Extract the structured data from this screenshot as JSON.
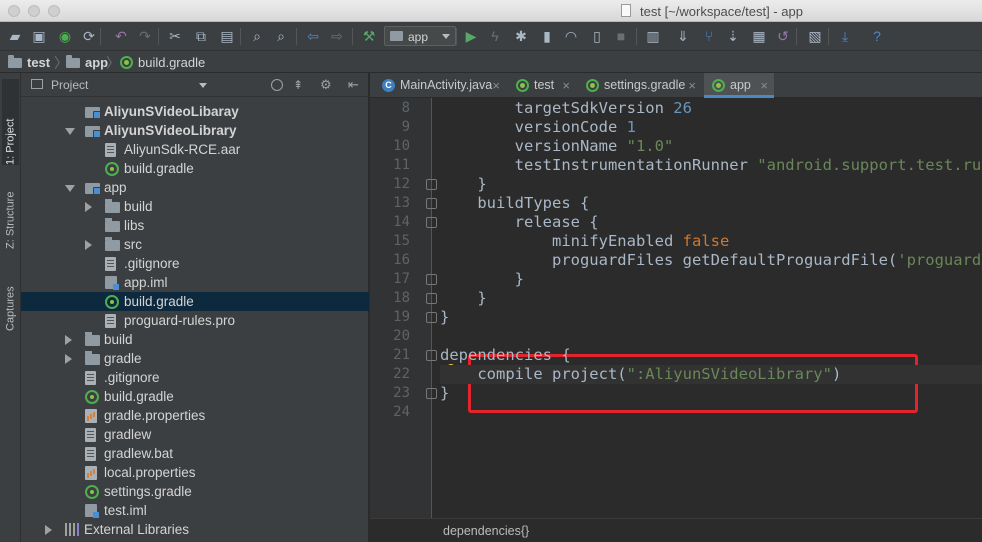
{
  "window": {
    "title": "test [~/workspace/test] - app"
  },
  "toolbar": {
    "run_config": "app",
    "icons": [
      "open-folder-icon",
      "save-icon",
      "sync-icon",
      "refresh-icon",
      "undo-icon",
      "redo-icon",
      "cut-icon",
      "copy-icon",
      "paste-icon",
      "find-icon",
      "replace-icon",
      "back-icon",
      "forward-icon",
      "build-hammer-icon",
      "run-icon",
      "apply-changes-icon",
      "debug-icon",
      "coverage-icon",
      "profile-icon",
      "attach-debugger-icon",
      "stop-icon",
      "avd-manager-icon",
      "sync-gradle-icon",
      "git-icon",
      "sdk-manager-icon",
      "device-monitor-icon",
      "revert-icon",
      "project-structure-icon",
      "download-icon",
      "help-icon"
    ],
    "help_glyph": "?"
  },
  "breadcrumb": {
    "items": [
      "test",
      "app",
      "build.gradle"
    ],
    "separator": "〉"
  },
  "tool_strip": {
    "tabs": [
      "1: Project",
      "Z: Structure",
      "Captures"
    ]
  },
  "project_panel": {
    "view": "Project",
    "tree": [
      {
        "label": "AliyunSVideoLibaray",
        "icon": "module",
        "indent": 1,
        "arrow": "",
        "bold": true
      },
      {
        "label": "AliyunSVideoLibrary",
        "icon": "module",
        "indent": 1,
        "arrow": "down",
        "bold": true
      },
      {
        "label": "AliyunSdk-RCE.aar",
        "icon": "file",
        "indent": 2,
        "arrow": ""
      },
      {
        "label": "build.gradle",
        "icon": "gradle",
        "indent": 2,
        "arrow": ""
      },
      {
        "label": "app",
        "icon": "module",
        "indent": 1,
        "arrow": "down"
      },
      {
        "label": "build",
        "icon": "folder",
        "indent": 2,
        "arrow": "right"
      },
      {
        "label": "libs",
        "icon": "folder",
        "indent": 2,
        "arrow": ""
      },
      {
        "label": "src",
        "icon": "folder",
        "indent": 2,
        "arrow": "right"
      },
      {
        "label": ".gitignore",
        "icon": "file",
        "indent": 2,
        "arrow": ""
      },
      {
        "label": "app.iml",
        "icon": "iml",
        "indent": 2,
        "arrow": ""
      },
      {
        "label": "build.gradle",
        "icon": "gradle",
        "indent": 2,
        "arrow": "",
        "selected": true
      },
      {
        "label": "proguard-rules.pro",
        "icon": "file",
        "indent": 2,
        "arrow": ""
      },
      {
        "label": "build",
        "icon": "folder",
        "indent": 1,
        "arrow": "right"
      },
      {
        "label": "gradle",
        "icon": "folder",
        "indent": 1,
        "arrow": "right"
      },
      {
        "label": ".gitignore",
        "icon": "file",
        "indent": 1,
        "arrow": ""
      },
      {
        "label": "build.gradle",
        "icon": "gradle",
        "indent": 1,
        "arrow": ""
      },
      {
        "label": "gradle.properties",
        "icon": "props",
        "indent": 1,
        "arrow": ""
      },
      {
        "label": "gradlew",
        "icon": "file",
        "indent": 1,
        "arrow": ""
      },
      {
        "label": "gradlew.bat",
        "icon": "file",
        "indent": 1,
        "arrow": ""
      },
      {
        "label": "local.properties",
        "icon": "props",
        "indent": 1,
        "arrow": ""
      },
      {
        "label": "settings.gradle",
        "icon": "gradle",
        "indent": 1,
        "arrow": ""
      },
      {
        "label": "test.iml",
        "icon": "iml",
        "indent": 1,
        "arrow": ""
      },
      {
        "label": "External Libraries",
        "icon": "libs",
        "indent": 0,
        "arrow": "right"
      }
    ]
  },
  "editor_tabs": [
    {
      "label": "MainActivity.java",
      "icon": "java",
      "glyph": "C"
    },
    {
      "label": "test",
      "icon": "gradle"
    },
    {
      "label": "settings.gradle",
      "icon": "gradle"
    },
    {
      "label": "app",
      "icon": "gradle",
      "active": true
    }
  ],
  "tab_close_glyph": "×",
  "editor": {
    "lines": [
      {
        "n": "8",
        "tokens": [
          [
            "",
            "        targetSdkVersion "
          ],
          [
            "num",
            "26"
          ]
        ]
      },
      {
        "n": "9",
        "tokens": [
          [
            "",
            "        versionCode "
          ],
          [
            "num",
            "1"
          ]
        ]
      },
      {
        "n": "10",
        "tokens": [
          [
            "",
            "        versionName "
          ],
          [
            "str",
            "\"1.0\""
          ]
        ]
      },
      {
        "n": "11",
        "tokens": [
          [
            "",
            "        testInstrumentationRunner "
          ],
          [
            "str",
            "\"android.support.test.runner.AndroidJUnitRunner\""
          ]
        ]
      },
      {
        "n": "12",
        "tokens": [
          [
            "",
            "    }"
          ]
        ]
      },
      {
        "n": "13",
        "tokens": [
          [
            "",
            "    buildTypes {"
          ]
        ]
      },
      {
        "n": "14",
        "tokens": [
          [
            "",
            "        release {"
          ]
        ]
      },
      {
        "n": "15",
        "tokens": [
          [
            "",
            "            minifyEnabled "
          ],
          [
            "kw",
            "false"
          ]
        ]
      },
      {
        "n": "16",
        "tokens": [
          [
            "",
            "            proguardFiles getDefaultProguardFile("
          ],
          [
            "str",
            "'proguard-android.txt'"
          ]
        ]
      },
      {
        "n": "17",
        "tokens": [
          [
            "",
            "        }"
          ]
        ]
      },
      {
        "n": "18",
        "tokens": [
          [
            "",
            "    }"
          ]
        ]
      },
      {
        "n": "19",
        "tokens": [
          [
            "",
            "}"
          ]
        ]
      },
      {
        "n": "20",
        "tokens": [
          [
            "",
            ""
          ]
        ]
      },
      {
        "n": "21",
        "tokens": [
          [
            "",
            "dependencies {"
          ]
        ]
      },
      {
        "n": "22",
        "tokens": [
          [
            "",
            "    compile project("
          ],
          [
            "str",
            "\":AliyunSVideoLibrary\""
          ],
          [
            "",
            ")"
          ]
        ],
        "current": true
      },
      {
        "n": "23",
        "tokens": [
          [
            "",
            "}"
          ]
        ]
      },
      {
        "n": "24",
        "tokens": [
          [
            "",
            ""
          ]
        ]
      }
    ],
    "status_breadcrumb": "dependencies{}"
  },
  "colors": {
    "accent": "#4a88c7",
    "annotation_box": "#e3242b",
    "keyword": "#cc7832",
    "string": "#6a8759",
    "number": "#6897bb"
  }
}
